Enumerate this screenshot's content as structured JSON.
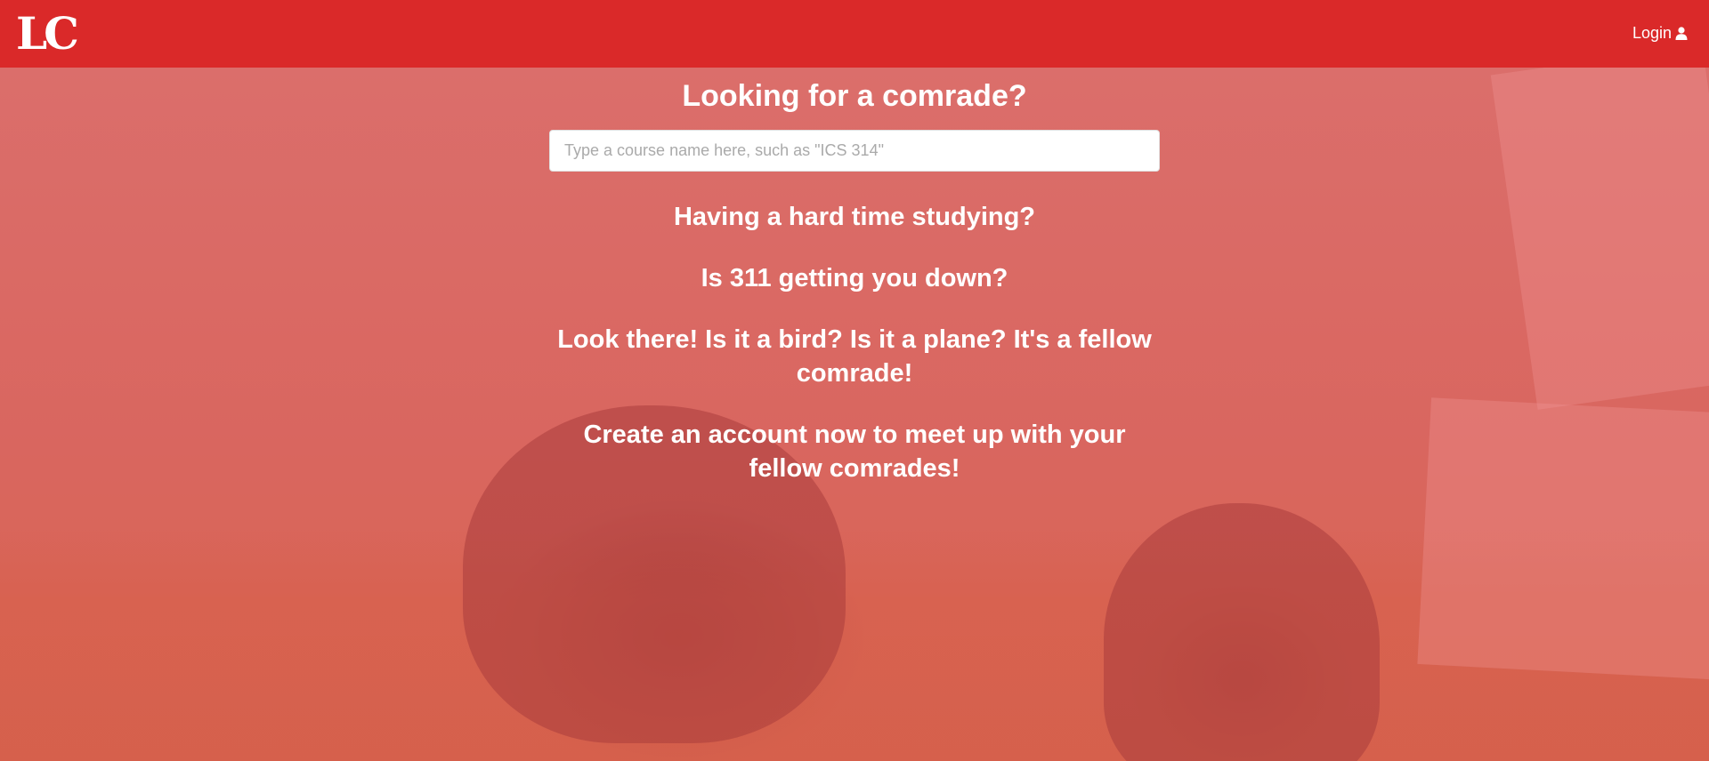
{
  "navbar": {
    "logo": "LC",
    "login_label": "Login",
    "color": "#da2929"
  },
  "main": {
    "heading": "Looking for a comrade?",
    "search_placeholder": "Type a course name here, such as \"ICS 314\"",
    "lines": [
      "Having a hard time studying?",
      "Is 311 getting you down?",
      "Look there! Is it a bird? Is it a plane? It's a fellow comrade!",
      "Create an account now to meet up with your fellow comrades!"
    ]
  },
  "icons": {
    "login": "user-icon"
  }
}
